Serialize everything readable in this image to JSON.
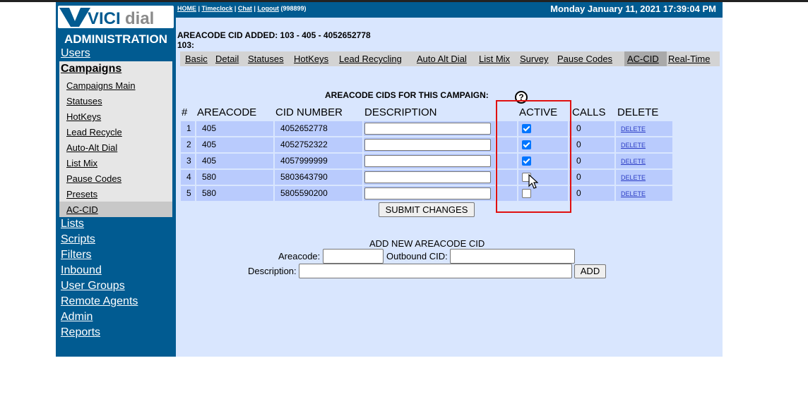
{
  "header": {
    "links": [
      "HOME",
      "Timeclock",
      "Chat",
      "Logout"
    ],
    "user_id": "(998899)",
    "datetime": "Monday January 11, 2021 17:39:04 PM"
  },
  "sidebar": {
    "logo_text": "VICIdial",
    "admin_title": "ADMINISTRATION",
    "users": "Users",
    "campaigns": "Campaigns",
    "campaign_items": [
      "Campaigns Main",
      "Statuses",
      "HotKeys",
      "Lead Recycle",
      "Auto-Alt Dial",
      "List Mix",
      "Pause Codes",
      "Presets",
      "AC-CID"
    ],
    "other_items": [
      "Lists",
      "Scripts",
      "Filters",
      "Inbound",
      "User Groups",
      "Remote Agents",
      "Admin",
      "Reports"
    ]
  },
  "notice": {
    "line1": "AREACODE CID ADDED: 103 - 405 - 4052652778",
    "line2": "103:"
  },
  "tabs": [
    "Basic",
    "Detail",
    "Statuses",
    "HotKeys",
    "Lead Recycling",
    "Auto Alt Dial",
    "List Mix",
    "Survey",
    "Pause Codes",
    "AC-CID",
    "Real-Time"
  ],
  "active_tab": "AC-CID",
  "table": {
    "title": "AREACODE CIDS FOR THIS CAMPAIGN:",
    "help": "?",
    "columns": [
      "#",
      "AREACODE",
      "CID NUMBER",
      "DESCRIPTION",
      "ACTIVE",
      "CALLS",
      "DELETE"
    ],
    "rows": [
      {
        "num": "1",
        "areacode": "405",
        "cid": "4052652778",
        "description": "",
        "active": true,
        "calls": "0",
        "delete": "DELETE"
      },
      {
        "num": "2",
        "areacode": "405",
        "cid": "4052752322",
        "description": "",
        "active": true,
        "calls": "0",
        "delete": "DELETE"
      },
      {
        "num": "3",
        "areacode": "405",
        "cid": "4057999999",
        "description": "",
        "active": true,
        "calls": "0",
        "delete": "DELETE"
      },
      {
        "num": "4",
        "areacode": "580",
        "cid": "5803643790",
        "description": "",
        "active": false,
        "calls": "0",
        "delete": "DELETE"
      },
      {
        "num": "5",
        "areacode": "580",
        "cid": "5805590200",
        "description": "",
        "active": false,
        "calls": "0",
        "delete": "DELETE"
      }
    ],
    "submit": "SUBMIT CHANGES"
  },
  "add_form": {
    "title": "ADD NEW AREACODE CID",
    "areacode_label": "Areacode:",
    "areacode_value": "",
    "outbound_label": "Outbound CID:",
    "outbound_value": "",
    "description_label": "Description:",
    "description_value": "",
    "add_button": "ADD"
  },
  "colors": {
    "sidebar": "#015B91",
    "main_bg": "#D9E6FE",
    "row_bg": "#B9CBFD",
    "highlight": "#E01010",
    "checkbox": "#0075FF"
  }
}
